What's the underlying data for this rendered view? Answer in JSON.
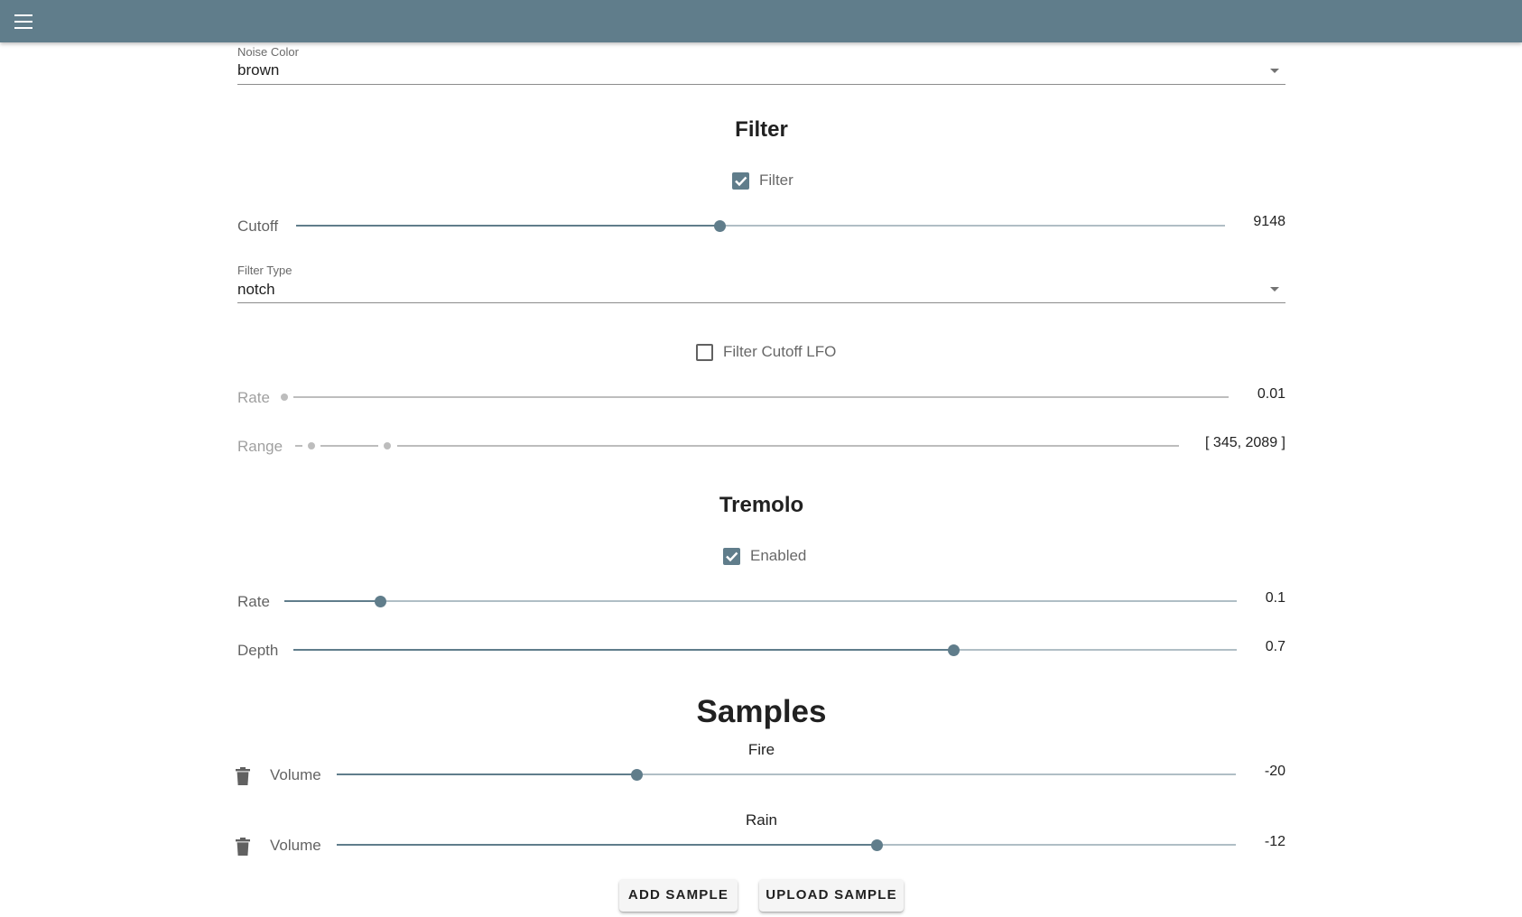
{
  "colors": {
    "appbar": "#607d8b",
    "accent": "#607d8b",
    "rail": "#b0bec5",
    "disabled": "#bdbdbd"
  },
  "appbar": {
    "menu_icon": "menu-icon"
  },
  "noise": {
    "label": "Noise Color",
    "value": "brown"
  },
  "filter": {
    "heading": "Filter",
    "checkbox_label": "Filter",
    "checked": true,
    "cutoff": {
      "label": "Cutoff",
      "value": "9148",
      "fraction": 0.456
    },
    "type": {
      "label": "Filter Type",
      "value": "notch"
    },
    "lfo": {
      "checkbox_label": "Filter Cutoff LFO",
      "checked": false,
      "rate": {
        "label": "Rate",
        "value": "0.01",
        "fraction": 0.0
      },
      "range": {
        "label": "Range",
        "value": "[ 345, 2089 ]",
        "low_fraction": 0.0,
        "high_fraction": 0.087
      }
    }
  },
  "tremolo": {
    "heading": "Tremolo",
    "checkbox_label": "Enabled",
    "checked": true,
    "rate": {
      "label": "Rate",
      "value": "0.1",
      "fraction": 0.1
    },
    "depth": {
      "label": "Depth",
      "value": "0.7",
      "fraction": 0.7
    }
  },
  "samples": {
    "heading": "Samples",
    "items": [
      {
        "name": "Fire",
        "volume_label": "Volume",
        "value": "-20",
        "fraction": 0.333,
        "delete_icon": "trash-icon"
      },
      {
        "name": "Rain",
        "volume_label": "Volume",
        "value": "-12",
        "fraction": 0.6,
        "delete_icon": "trash-icon"
      }
    ],
    "add_button": "ADD SAMPLE",
    "upload_button": "UPLOAD SAMPLE"
  }
}
